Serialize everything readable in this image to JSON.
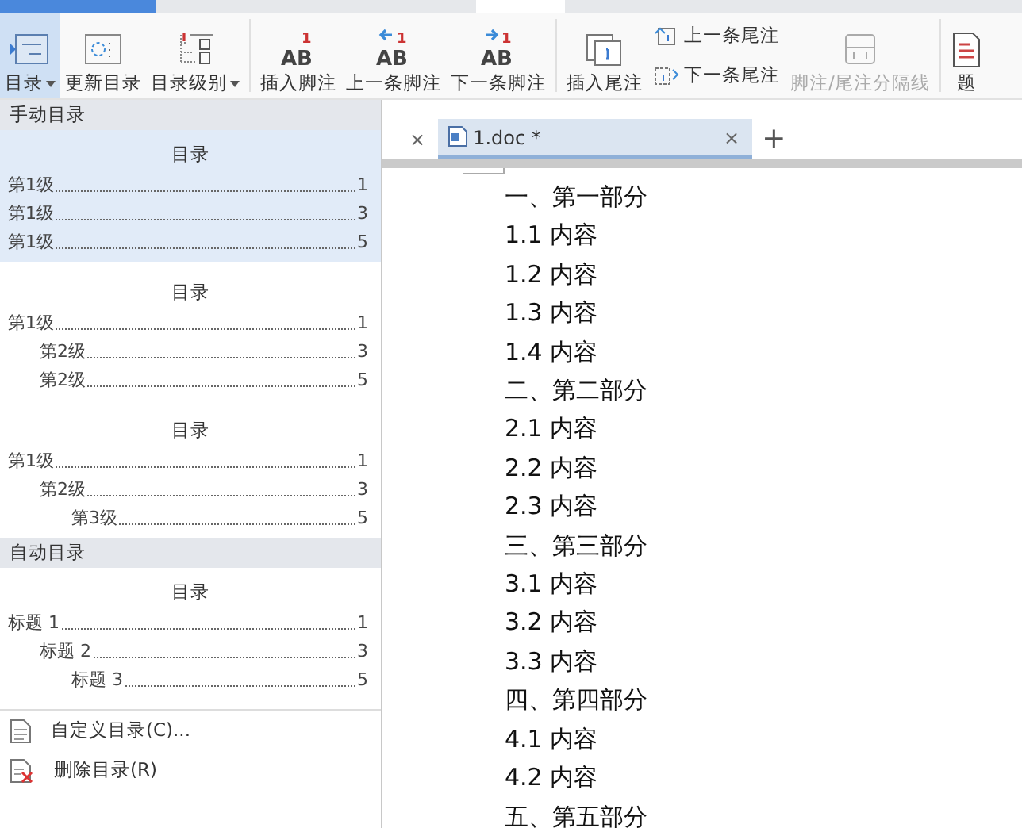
{
  "ribbon": {
    "buttons": [
      {
        "kind": "large",
        "label": "目录",
        "dropdown": true,
        "selected": true,
        "disabled": false
      },
      {
        "kind": "large",
        "label": "更新目录",
        "dropdown": false,
        "selected": false,
        "disabled": false
      },
      {
        "kind": "large",
        "label": "目录级别",
        "dropdown": true,
        "selected": false,
        "disabled": false
      },
      {
        "kind": "separator"
      },
      {
        "kind": "large",
        "icon_text": "AB",
        "icon_mark": "1",
        "label": "插入脚注",
        "dropdown": false,
        "selected": false,
        "disabled": false
      },
      {
        "kind": "large",
        "icon_text": "AB",
        "icon_mark": "1",
        "label": "上一条脚注",
        "dropdown": false,
        "selected": false,
        "disabled": false
      },
      {
        "kind": "large",
        "icon_text": "AB",
        "icon_mark": "1",
        "label": "下一条脚注",
        "dropdown": false,
        "selected": false,
        "disabled": false
      },
      {
        "kind": "separator"
      },
      {
        "kind": "large",
        "label": "插入尾注",
        "dropdown": false,
        "selected": false,
        "disabled": false
      },
      {
        "kind": "stack",
        "items": [
          {
            "label": "上一条尾注",
            "selected": false,
            "disabled": false
          },
          {
            "label": "下一条尾注",
            "selected": false,
            "disabled": false
          }
        ]
      },
      {
        "kind": "large",
        "label": "脚注/尾注分隔线",
        "dropdown": false,
        "selected": false,
        "disabled": true
      },
      {
        "kind": "separator"
      },
      {
        "kind": "large",
        "label": "题",
        "dropdown": false,
        "selected": false,
        "disabled": false
      }
    ]
  },
  "doc_tabs": [
    {
      "close": "×",
      "selected": false
    },
    {
      "label": "1.doc *",
      "close": "×",
      "selected": true
    }
  ],
  "new_tab": "+",
  "document": {
    "lines": [
      "一、第一部分",
      "1.1 内容",
      "1.2 内容",
      "1.3 内容",
      "1.4 内容",
      "二、第二部分",
      "2.1 内容",
      "2.2 内容",
      "2.3 内容",
      "三、第三部分",
      "3.1 内容",
      "3.2 内容",
      "3.3 内容",
      "四、第四部分",
      "4.1 内容",
      "4.2 内容",
      "五、第五部分"
    ]
  },
  "toc_menu": {
    "sections": [
      {
        "title": "手动目录",
        "styles": [
          {
            "heading": "目录",
            "selected": true,
            "entries": [
              {
                "label": "第1级",
                "page": "1"
              },
              {
                "label": "第1级",
                "page": "3"
              },
              {
                "label": "第1级",
                "page": "5"
              }
            ]
          },
          {
            "heading": "目录",
            "selected": false,
            "entries": [
              {
                "label": "第1级",
                "page": "1",
                "children": [
                  {
                    "label": "第2级",
                    "page": "3"
                  },
                  {
                    "label": "第2级",
                    "page": "5"
                  }
                ]
              }
            ]
          },
          {
            "heading": "目录",
            "selected": false,
            "entries": [
              {
                "label": "第1级",
                "page": "1",
                "children": [
                  {
                    "label": "第2级",
                    "page": "3",
                    "children": [
                      {
                        "label": "第3级",
                        "page": "5"
                      }
                    ]
                  }
                ]
              }
            ]
          }
        ]
      },
      {
        "title": "自动目录",
        "styles": [
          {
            "heading": "目录",
            "selected": false,
            "entries": [
              {
                "label": "标题 1",
                "page": "1",
                "children": [
                  {
                    "label": "标题 2",
                    "page": "3",
                    "children": [
                      {
                        "label": "标题 3",
                        "page": "5"
                      }
                    ]
                  }
                ]
              }
            ]
          }
        ]
      }
    ],
    "commands": [
      {
        "label": "自定义目录(C)..."
      },
      {
        "label": "删除目录(R)"
      }
    ]
  }
}
